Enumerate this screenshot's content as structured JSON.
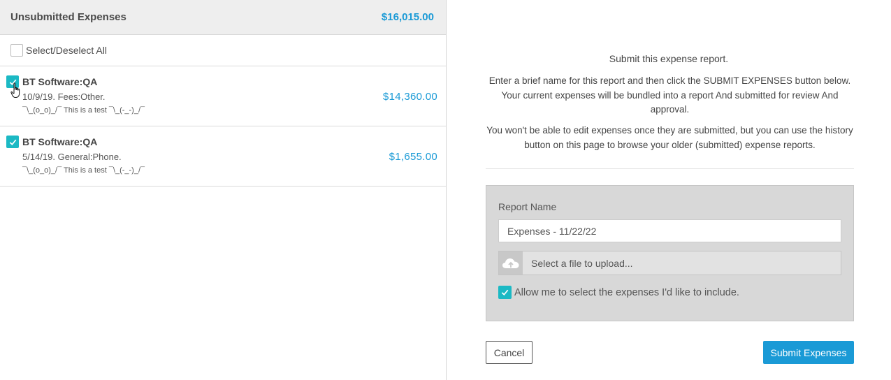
{
  "unsubmitted": {
    "title": "Unsubmitted Expenses",
    "total": "$16,015.00",
    "select_all_label": "Select/Deselect All",
    "select_all_checked": false,
    "items": [
      {
        "title": "BT Software:QA",
        "subtitle": "10/9/19. Fees:Other.",
        "memo": "¯\\_(o_o)_/¯ This is a test ¯\\_(-_-)_/¯",
        "amount": "$14,360.00",
        "checked": true
      },
      {
        "title": "BT Software:QA",
        "subtitle": "5/14/19. General:Phone.",
        "memo": "¯\\_(o_o)_/¯ This is a test ¯\\_(-_-)_/¯",
        "amount": "$1,655.00",
        "checked": true
      }
    ]
  },
  "submit_panel": {
    "heading": "Submit this expense report.",
    "paragraph1": "Enter a brief name for this report and then click the SUBMIT EXPENSES button below. Your current expenses will be bundled into a report And submitted for review And approval.",
    "paragraph2": "You won't be able to edit expenses once they are submitted, but you can use the history button on this page to browse your older (submitted) expense reports.",
    "form": {
      "report_name_label": "Report Name",
      "report_name_value": "Expenses - 11/22/22",
      "upload_label": "Select a file to upload...",
      "upload_icon": "cloud-upload-icon",
      "allow_select_label": "Allow me to select the expenses I'd like to include.",
      "allow_select_checked": true
    },
    "cancel_label": "Cancel",
    "submit_label": "Submit Expenses"
  },
  "colors": {
    "accent_blue": "#1a9ad6",
    "checkbox_teal": "#1bb9c4",
    "form_bg": "#d8d8d8"
  }
}
